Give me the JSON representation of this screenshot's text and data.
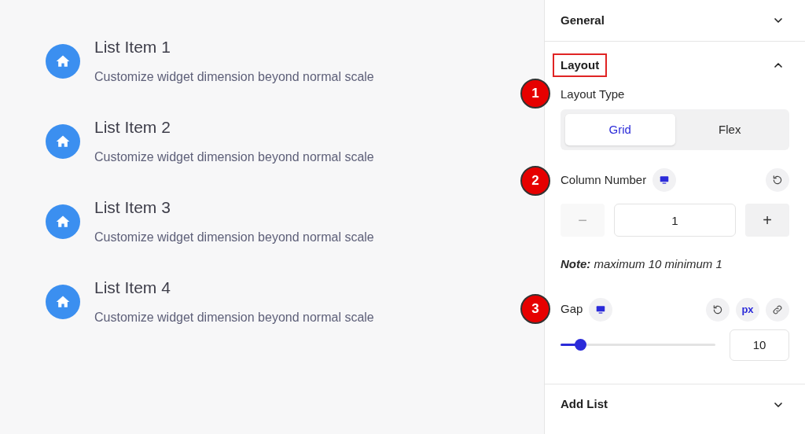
{
  "preview": {
    "items": [
      {
        "title": "List Item 1",
        "description": "Customize widget dimension beyond normal scale"
      },
      {
        "title": "List Item 2",
        "description": "Customize widget dimension beyond normal scale"
      },
      {
        "title": "List Item 3",
        "description": "Customize widget dimension beyond normal scale"
      },
      {
        "title": "List Item 4",
        "description": "Customize widget dimension beyond normal scale"
      }
    ]
  },
  "panel": {
    "sections": [
      {
        "title": "General",
        "expanded": false,
        "highlighted": false
      },
      {
        "title": "Layout",
        "expanded": true,
        "highlighted": true,
        "layout_type": {
          "marker": "1",
          "label": "Layout Type",
          "options": [
            {
              "label": "Grid",
              "selected": true
            },
            {
              "label": "Flex",
              "selected": false
            }
          ]
        },
        "column_number": {
          "marker": "2",
          "label": "Column Number",
          "value": "1",
          "decrement_label": "−",
          "increment_label": "+",
          "decrement_disabled": true,
          "note": "**Note:** maximum 10 minimum 1"
        },
        "gap": {
          "marker": "3",
          "label": "Gap",
          "unit": "px",
          "level": 0.1,
          "value": "10"
        }
      },
      {
        "title": "Add List",
        "expanded": false,
        "highlighted": false
      }
    ]
  }
}
